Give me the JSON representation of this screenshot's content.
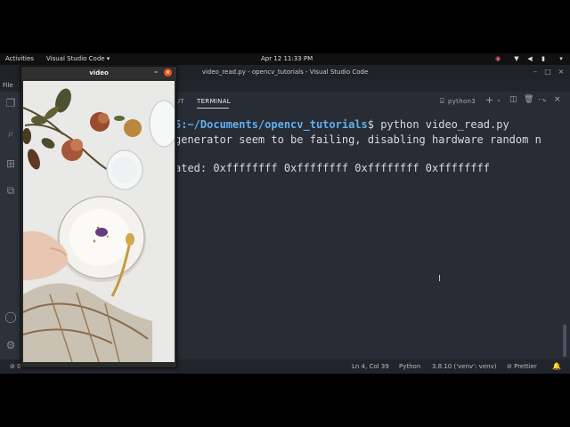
{
  "gnome": {
    "activities": "Activities",
    "app_menu": "Visual Studio Code ▾",
    "clock": "Apr 12  11:33 PM"
  },
  "vscode": {
    "window_title": "video_read.py - opencv_tutorials - Visual Studio Code",
    "menu_file": "File",
    "panel_tab_partial": "UT",
    "panel_tab_terminal": "TERMINAL",
    "terminal_profile": "python3",
    "terminal_lines": [
      {
        "path": "5:~/Documents/opencv_tutorials",
        "text": "$ python video_read.py"
      },
      {
        "text": "generator seem to be failing, disabling hardware random n"
      },
      {
        "text": "ated: 0xffffffff 0xffffffff 0xffffffff 0xffffffff"
      }
    ],
    "status": {
      "problems": "⊘ 0 ⚠ 0",
      "position": "Ln 4, Col 39",
      "language": "Python",
      "interpreter": "3.8.10 ('venv': venv)",
      "prettier": "⊘ Prettier"
    }
  },
  "video_window": {
    "title": "video",
    "minimize": "–",
    "close": "×"
  },
  "colors": {
    "terminal_bg": "#282c34",
    "path_color": "#61afef",
    "close_button": "#e95420"
  }
}
